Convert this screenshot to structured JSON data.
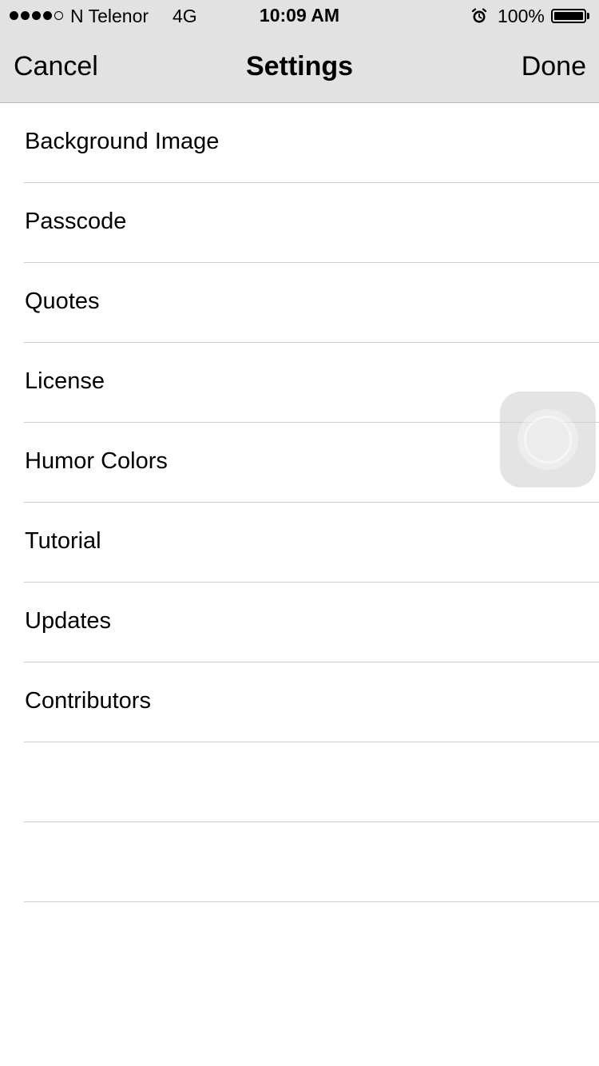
{
  "status_bar": {
    "signal_bars_filled": 4,
    "signal_bars_total": 5,
    "carrier": "N Telenor",
    "network": "4G",
    "time": "10:09 AM",
    "alarm_icon": "alarm-clock-icon",
    "battery_percent": "100%",
    "battery_level": 1.0
  },
  "nav": {
    "cancel_label": "Cancel",
    "title": "Settings",
    "done_label": "Done"
  },
  "settings": {
    "items": [
      {
        "label": "Background Image"
      },
      {
        "label": "Passcode"
      },
      {
        "label": "Quotes"
      },
      {
        "label": "License"
      },
      {
        "label": "Humor Colors"
      },
      {
        "label": "Tutorial"
      },
      {
        "label": "Updates"
      },
      {
        "label": "Contributors"
      },
      {
        "label": ""
      },
      {
        "label": ""
      }
    ]
  },
  "colors": {
    "bar_background": "#e2e2e2",
    "separator": "#cfcfcf",
    "text": "#000000"
  }
}
